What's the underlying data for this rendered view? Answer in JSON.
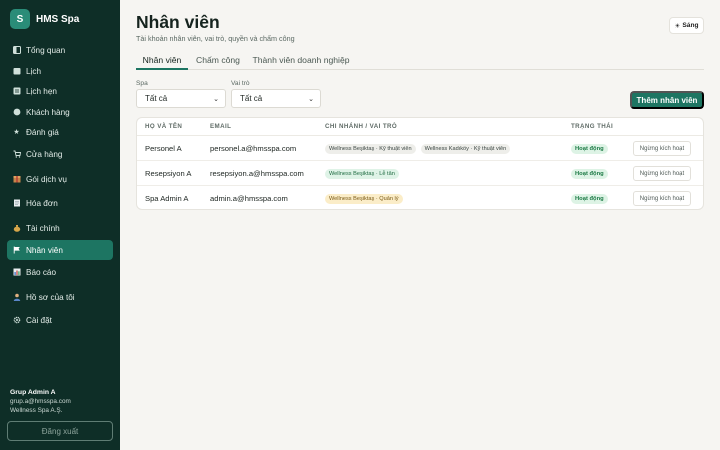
{
  "app": {
    "logo_letter": "S",
    "name": "HMS Spa"
  },
  "sidebar": {
    "items": [
      {
        "label": "Tổng quan",
        "icon": "dashboard-icon"
      },
      {
        "label": "Lịch",
        "icon": "calendar-icon"
      },
      {
        "label": "Lịch hẹn",
        "icon": "appointments-icon"
      },
      {
        "label": "Khách hàng",
        "icon": "customers-icon"
      },
      {
        "label": "Đánh giá",
        "icon": "star-icon"
      },
      {
        "label": "Cửa hàng",
        "icon": "cart-icon"
      },
      {
        "label": "Gói dịch vụ",
        "icon": "package-icon"
      },
      {
        "label": "Hóa đơn",
        "icon": "invoice-icon"
      },
      {
        "label": "Tài chính",
        "icon": "money-bag-icon"
      },
      {
        "label": "Nhân viên",
        "icon": "flag-icon",
        "active": true
      },
      {
        "label": "Báo cáo",
        "icon": "chart-icon"
      },
      {
        "label": "Hồ sơ của tôi",
        "icon": "profile-icon"
      },
      {
        "label": "Cài đặt",
        "icon": "gear-icon"
      }
    ],
    "user": {
      "name": "Grup Admin A",
      "email": "grup.a@hmsspa.com",
      "company": "Wellness Spa A.Ş."
    },
    "logout_label": "Đăng xuất"
  },
  "header": {
    "title": "Nhân viên",
    "subtitle": "Tài khoản nhân viên, vai trò, quyền và chấm công",
    "theme_label": "Sáng",
    "theme_icon": "sun-icon"
  },
  "tabs": [
    {
      "label": "Nhân viên",
      "active": true
    },
    {
      "label": "Chấm công"
    },
    {
      "label": "Thành viên doanh nghiệp"
    }
  ],
  "filters": {
    "spa": {
      "label": "Spa",
      "value": "Tất cả"
    },
    "role": {
      "label": "Vai trò",
      "value": "Tất cả"
    }
  },
  "add_button_label": "Thêm nhân viên",
  "table": {
    "columns": [
      "HỌ VÀ TÊN",
      "EMAIL",
      "CHI NHÁNH / VAI TRÒ",
      "TRẠNG THÁI"
    ],
    "rows": [
      {
        "name": "Personel A",
        "email": "personel.a@hmsspa.com",
        "tags": [
          {
            "text": "Wellness Beşiktaş · Kỹ thuật viên",
            "style": "grey"
          },
          {
            "text": "Wellness Kadıköy · Kỹ thuật viên",
            "style": "grey"
          }
        ],
        "status": "Hoạt động",
        "action": "Ngừng kích hoạt"
      },
      {
        "name": "Resepsiyon A",
        "email": "resepsiyon.a@hmsspa.com",
        "tags": [
          {
            "text": "Wellness Beşiktaş · Lễ tân",
            "style": "green"
          }
        ],
        "status": "Hoạt động",
        "action": "Ngừng kích hoạt"
      },
      {
        "name": "Spa Admin A",
        "email": "admin.a@hmsspa.com",
        "tags": [
          {
            "text": "Wellness Beşiktaş · Quản lý",
            "style": "amber"
          }
        ],
        "status": "Hoạt động",
        "action": "Ngừng kích hoạt"
      }
    ]
  },
  "colors": {
    "sidebar_bg": "#0e2e27",
    "accent": "#1d7562",
    "status_green": "#1c7a45"
  }
}
